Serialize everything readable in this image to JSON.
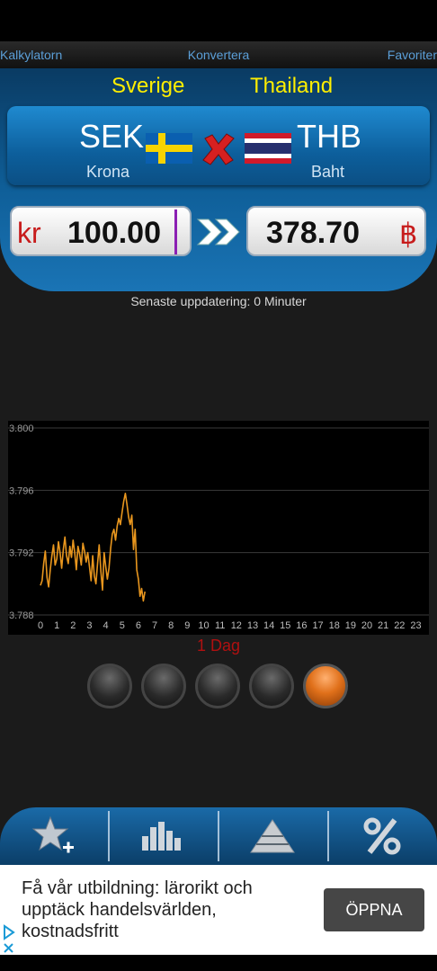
{
  "tabs": {
    "left": "Kalkylatorn",
    "center": "Konvertera",
    "right": "Favoriter"
  },
  "from": {
    "country": "Sverige",
    "code": "SEK",
    "name": "Krona",
    "symbol": "kr",
    "amount": "100.00"
  },
  "to": {
    "country": "Thailand",
    "code": "THB",
    "name": "Baht",
    "symbol": "฿",
    "amount": "378.70"
  },
  "update_text": "Senaste uppdatering: 0 Minuter",
  "chart_data": {
    "type": "line",
    "title": "",
    "xlabel": "",
    "ylabel": "",
    "x_ticks": [
      "0",
      "1",
      "2",
      "3",
      "4",
      "5",
      "6",
      "7",
      "8",
      "9",
      "10",
      "11",
      "12",
      "13",
      "14",
      "15",
      "16",
      "17",
      "18",
      "19",
      "20",
      "21",
      "22",
      "23"
    ],
    "y_ticks": [
      "3.788",
      "3.792",
      "3.796",
      "3.800"
    ],
    "ylim": [
      3.788,
      3.8
    ],
    "xlim": [
      0,
      23.8
    ],
    "grid": true,
    "series": [
      {
        "color": "#e8961e",
        "x": [
          0.0,
          0.1,
          0.2,
          0.3,
          0.4,
          0.5,
          0.6,
          0.7,
          0.8,
          0.9,
          1.0,
          1.1,
          1.2,
          1.3,
          1.4,
          1.5,
          1.6,
          1.7,
          1.8,
          1.9,
          2.0,
          2.1,
          2.2,
          2.3,
          2.4,
          2.5,
          2.6,
          2.7,
          2.8,
          2.9,
          3.0,
          3.1,
          3.2,
          3.3,
          3.4,
          3.5,
          3.6,
          3.7,
          3.8,
          3.9,
          4.0,
          4.1,
          4.2,
          4.3,
          4.4,
          4.5,
          4.6,
          4.7,
          4.8,
          4.9,
          5.0,
          5.1,
          5.2,
          5.3,
          5.4,
          5.5,
          5.6,
          5.7,
          5.8,
          5.9,
          6.0,
          6.1,
          6.2,
          6.3,
          6.4
        ],
        "y": [
          3.7899,
          3.7902,
          3.7913,
          3.7921,
          3.7904,
          3.7898,
          3.7909,
          3.7918,
          3.7925,
          3.7912,
          3.7916,
          3.7927,
          3.792,
          3.791,
          3.7922,
          3.793,
          3.7918,
          3.7913,
          3.7924,
          3.7917,
          3.7928,
          3.792,
          3.7909,
          3.7924,
          3.7919,
          3.7912,
          3.7926,
          3.7921,
          3.7914,
          3.792,
          3.7911,
          3.7902,
          3.7918,
          3.7905,
          3.79,
          3.7913,
          3.7925,
          3.7908,
          3.7896,
          3.792,
          3.7911,
          3.7903,
          3.791,
          3.7923,
          3.7932,
          3.7935,
          3.7928,
          3.7937,
          3.7942,
          3.7938,
          3.7946,
          3.7953,
          3.7958,
          3.7951,
          3.7943,
          3.7938,
          3.7944,
          3.7922,
          3.7935,
          3.7909,
          3.7903,
          3.7892,
          3.7897,
          3.7889,
          3.7895
        ]
      }
    ]
  },
  "period_label": "1 Dag",
  "ad": {
    "text": "Få vår utbildning: lärorikt och upptäck handelsvärlden, kostnadsfritt",
    "button": "ÖPPNA"
  },
  "icons": {
    "swap": "red-x-swap-icon",
    "convert": "double-arrow-icon",
    "favorites": "star-plus-icon",
    "chart": "bar-chart-icon",
    "pyramid": "pyramid-icon",
    "percent": "percent-icon"
  }
}
